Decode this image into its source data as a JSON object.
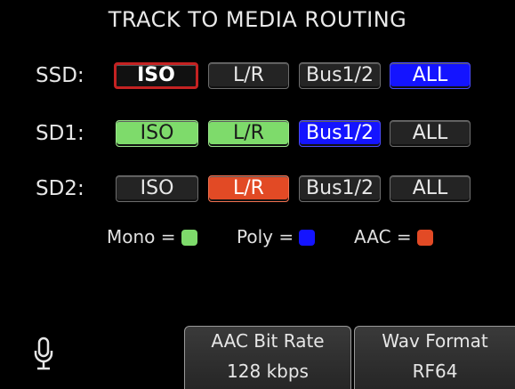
{
  "title": "TRACK TO MEDIA ROUTING",
  "rows": [
    {
      "label": "SSD:",
      "buttons": [
        "ISO",
        "L/R",
        "Bus1/2",
        "ALL"
      ]
    },
    {
      "label": "SD1:",
      "buttons": [
        "ISO",
        "L/R",
        "Bus1/2",
        "ALL"
      ]
    },
    {
      "label": "SD2:",
      "buttons": [
        "ISO",
        "L/R",
        "Bus1/2",
        "ALL"
      ]
    }
  ],
  "legend": {
    "mono": "Mono =",
    "poly": "Poly =",
    "aac": "AAC ="
  },
  "colors": {
    "mono": "#7edb6b",
    "poly": "#1414ff",
    "aac": "#e24a25",
    "selected_border": "#c42222"
  },
  "footer": {
    "aac_bit_rate": {
      "label": "AAC Bit Rate",
      "value": "128 kbps"
    },
    "wav_format": {
      "label": "Wav Format",
      "value": "RF64"
    }
  },
  "icons": {
    "mic": "microphone-icon"
  }
}
